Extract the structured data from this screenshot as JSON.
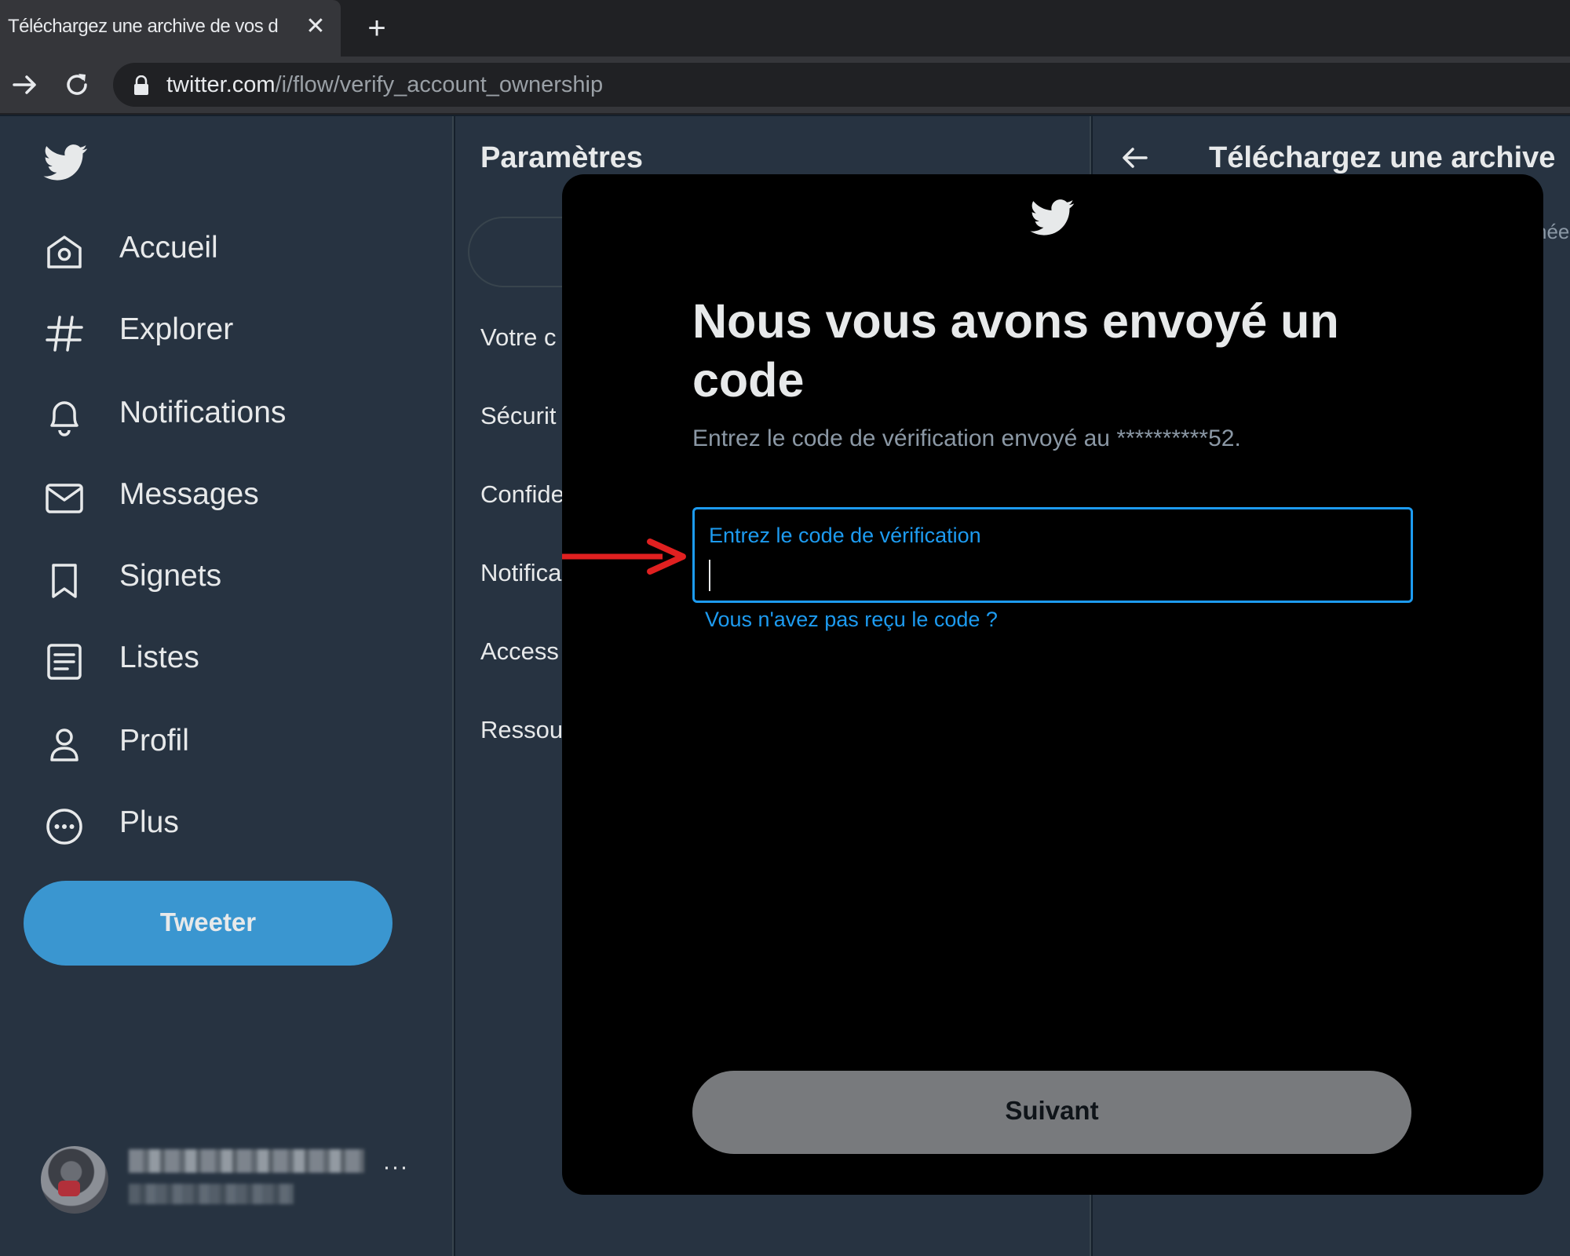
{
  "browser": {
    "tab_title": "Téléchargez une archive de vos d",
    "url_host": "twitter.com",
    "url_path": "/i/flow/verify_account_ownership",
    "icons": [
      "arrow-forward-icon",
      "reload-icon",
      "lock-icon",
      "close-icon",
      "plus-icon"
    ]
  },
  "sidebar": {
    "items": [
      {
        "label": "Accueil",
        "icon": "home-icon"
      },
      {
        "label": "Explorer",
        "icon": "hashtag-icon"
      },
      {
        "label": "Notifications",
        "icon": "bell-icon"
      },
      {
        "label": "Messages",
        "icon": "envelope-icon"
      },
      {
        "label": "Signets",
        "icon": "bookmark-icon"
      },
      {
        "label": "Listes",
        "icon": "list-icon"
      },
      {
        "label": "Profil",
        "icon": "person-icon"
      },
      {
        "label": "Plus",
        "icon": "more-circle-icon"
      }
    ],
    "tweet_button": "Tweeter",
    "account_more": "···"
  },
  "settings": {
    "title": "Paramètres",
    "items": [
      "Votre c",
      "Sécurit",
      "Confide",
      "Notifica",
      "Access",
      "Ressou"
    ]
  },
  "right": {
    "title": "Téléchargez une archive",
    "fragment": "née"
  },
  "modal": {
    "title": "Nous vous avons envoyé un code",
    "subtitle": "Entrez le code de vérification envoyé au **********52.",
    "code_label": "Entrez le code de vérification",
    "code_value": "",
    "resend_link": "Vous n'avez pas reçu le code ?",
    "next_button": "Suivant"
  },
  "colors": {
    "background": "#15202b",
    "panel": "#273341",
    "accent": "#1d9bf0",
    "tweet_button": "#3a96d0",
    "annotation_arrow": "#e02020"
  }
}
